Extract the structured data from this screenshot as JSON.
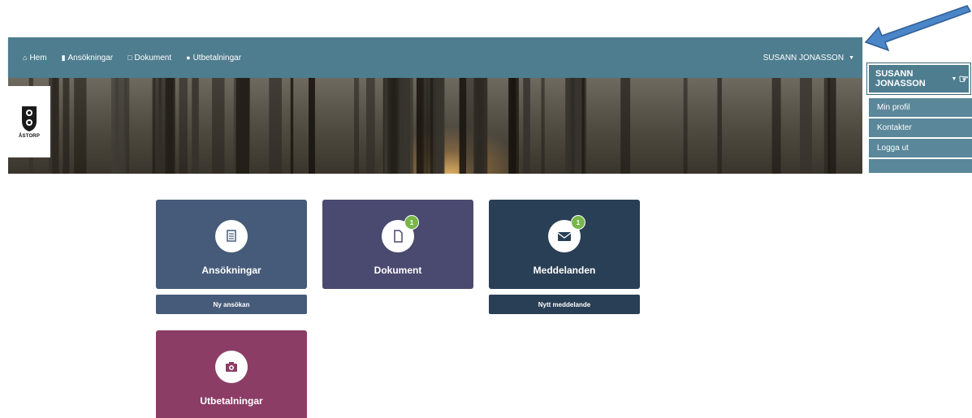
{
  "navbar": {
    "items": [
      {
        "icon": "home-icon",
        "label": "Hem"
      },
      {
        "icon": "application-icon",
        "label": "Ansökningar"
      },
      {
        "icon": "document-icon",
        "label": "Dokument"
      },
      {
        "icon": "payment-icon",
        "label": "Utbetalningar"
      }
    ],
    "user": "SUSANN JONASSON"
  },
  "logo": {
    "text": "ÅSTORP"
  },
  "dropdown": {
    "header": "SUSANN JONASSON",
    "items": [
      "Min profil",
      "Kontakter",
      "Logga ut"
    ]
  },
  "tiles": [
    {
      "label": "Ansökningar",
      "icon": "application-icon",
      "color": "#465b79",
      "action": "Ny ansökan"
    },
    {
      "label": "Dokument",
      "icon": "document-icon",
      "color": "#4a4a70",
      "badge": "1"
    },
    {
      "label": "Meddelanden",
      "icon": "envelope-icon",
      "color": "#293f55",
      "badge": "1",
      "action": "Nytt meddelande"
    },
    {
      "label": "Utbetalningar",
      "icon": "camera-icon",
      "color": "#8b3d66"
    }
  ],
  "colors": {
    "navbar": "#4e7d8f",
    "arrow": "#4a86c8",
    "badge": "#79b64b"
  }
}
